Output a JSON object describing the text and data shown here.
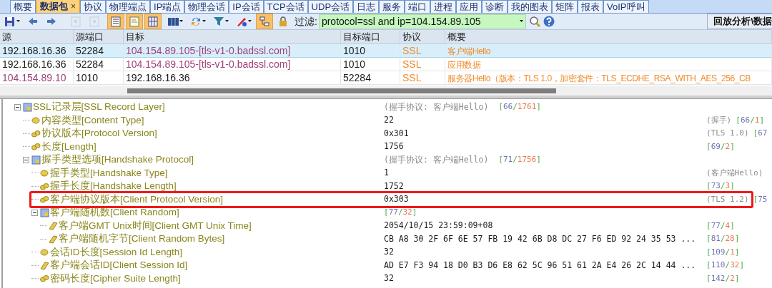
{
  "tabs": [
    {
      "label": "概要",
      "selected": false
    },
    {
      "label": "数据包",
      "selected": true,
      "close_glyph": "×"
    },
    {
      "label": "协议",
      "selected": false
    },
    {
      "label": "物理端点",
      "selected": false
    },
    {
      "label": "IP端点",
      "selected": false
    },
    {
      "label": "物理会话",
      "selected": false
    },
    {
      "label": "IP会话",
      "selected": false
    },
    {
      "label": "TCP会话",
      "selected": false
    },
    {
      "label": "UDP会话",
      "selected": false
    },
    {
      "label": "日志",
      "selected": false
    },
    {
      "label": "服务",
      "selected": false
    },
    {
      "label": "端口",
      "selected": false
    },
    {
      "label": "进程",
      "selected": false
    },
    {
      "label": "应用",
      "selected": false
    },
    {
      "label": "诊断",
      "selected": false
    },
    {
      "label": "我的图表",
      "selected": false
    },
    {
      "label": "矩阵",
      "selected": false
    },
    {
      "label": "报表",
      "selected": false
    },
    {
      "label": "VoIP呼叫",
      "selected": false
    }
  ],
  "toolbar": {
    "buttons": [
      {
        "kind": "save",
        "on": false,
        "disabled": false,
        "dropdown": true
      },
      {
        "kind": "back",
        "on": false,
        "disabled": false,
        "dropdown": false
      },
      {
        "kind": "forward",
        "on": false,
        "disabled": false,
        "dropdown": false
      },
      {
        "kind": "first",
        "on": false,
        "disabled": true,
        "dropdown": false
      },
      {
        "kind": "last",
        "on": false,
        "disabled": true,
        "dropdown": false
      },
      {
        "kind": "list",
        "on": true,
        "disabled": false,
        "dropdown": false
      },
      {
        "kind": "detail",
        "on": true,
        "disabled": false,
        "dropdown": false
      },
      {
        "kind": "hex",
        "on": true,
        "disabled": false,
        "dropdown": false
      },
      {
        "kind": "columns",
        "on": false,
        "disabled": false,
        "dropdown": true
      },
      {
        "kind": "sync",
        "on": false,
        "disabled": false,
        "dropdown": true
      },
      {
        "kind": "filter",
        "on": false,
        "disabled": false,
        "dropdown": true
      },
      {
        "kind": "colors",
        "on": false,
        "disabled": false,
        "dropdown": true
      },
      {
        "kind": "tree",
        "on": true,
        "disabled": false,
        "dropdown": false
      },
      {
        "kind": "lock",
        "on": false,
        "disabled": false,
        "dropdown": false
      }
    ],
    "filter": {
      "label": "过滤:",
      "value": "protocol=ssl and ip=104.154.89.105"
    },
    "filter_buttons": [
      {
        "kind": "search"
      },
      {
        "kind": "help"
      }
    ],
    "right_button": "回放分析\\数据"
  },
  "packets": {
    "columns": [
      "源",
      "源端口",
      "目标",
      "目标端口",
      "协议",
      "概要"
    ],
    "rows": [
      {
        "selected": true,
        "cells": [
          {
            "text": "192.168.16.36",
            "kind": "plain"
          },
          {
            "text": "52284",
            "kind": "plain"
          },
          {
            "text": "104.154.89.105-[tls-v1-0.badssl.com]",
            "kind": "host"
          },
          {
            "text": "1010",
            "kind": "plain"
          },
          {
            "text": "SSL",
            "kind": "proto"
          },
          {
            "text": "客户端Hello",
            "kind": "proto"
          }
        ]
      },
      {
        "selected": false,
        "cells": [
          {
            "text": "192.168.16.36",
            "kind": "plain"
          },
          {
            "text": "52284",
            "kind": "plain"
          },
          {
            "text": "104.154.89.105-[tls-v1-0.badssl.com]",
            "kind": "host"
          },
          {
            "text": "1010",
            "kind": "plain"
          },
          {
            "text": "SSL",
            "kind": "proto"
          },
          {
            "text": "应用数据",
            "kind": "proto"
          }
        ]
      },
      {
        "selected": false,
        "cells": [
          {
            "text": "104.154.89.10",
            "kind": "host"
          },
          {
            "text": "1010",
            "kind": "plain"
          },
          {
            "text": "192.168.16.36",
            "kind": "plain"
          },
          {
            "text": "52284",
            "kind": "plain"
          },
          {
            "text": "SSL",
            "kind": "proto"
          },
          {
            "text": "服务器Hello（版本：TLS 1.0，加密套件：TLS_ECDHE_RSA_WITH_AES_256_CB",
            "kind": "proto"
          }
        ]
      }
    ]
  },
  "details": {
    "tree": [
      {
        "kind": "group",
        "name": "SSL记录层[SSL Record Layer]",
        "expanded": true,
        "highlighted": false,
        "summary": "(握手协议: 客户端Hello)",
        "offset": {
          "open": "[",
          "start": "66",
          "sep": "/",
          "length": "1761",
          "close": "]"
        },
        "children": [
          {
            "kind": "byte",
            "name": "内容类型[Content Type]",
            "highlighted": false,
            "value": "22",
            "note": "(握手)",
            "offset": {
              "open": "[",
              "start": "66",
              "sep": "/",
              "length": "1",
              "close": "]"
            }
          },
          {
            "kind": "word",
            "name": "协议版本[Protocol Version]",
            "highlighted": false,
            "value": "0x301",
            "note": "(TLS 1.0)",
            "offset": {
              "open": "[",
              "start": "67"
            }
          },
          {
            "kind": "word",
            "name": "长度[Length]",
            "highlighted": false,
            "value": "1756",
            "offset": {
              "open": "[",
              "start": "69",
              "sep": "/",
              "length": "2",
              "close": "]"
            }
          },
          {
            "kind": "group",
            "name": "握手类型选项[Handshake Protocol]",
            "expanded": true,
            "highlighted": false,
            "summary": "(握手协议: 客户端Hello)",
            "offset": {
              "open": "[",
              "start": "71",
              "sep": "/",
              "length": "1756",
              "close": "]"
            },
            "children": [
              {
                "kind": "byte",
                "name": "握手类型[Handshake Type]",
                "highlighted": false,
                "value": "1",
                "note": "(客户端Hello)"
              },
              {
                "kind": "word",
                "name": "握手长度[Handshake Length]",
                "highlighted": false,
                "value": "1752",
                "offset": {
                  "open": "[",
                  "start": "73",
                  "sep": "/",
                  "length": "3",
                  "close": "]"
                }
              },
              {
                "kind": "word",
                "name": "客户端协议版本[Client Protocol Version]",
                "highlighted": true,
                "value": "0x303",
                "note": "(TLS 1.2)",
                "offset": {
                  "open": "[",
                  "start": "75"
                }
              },
              {
                "kind": "group",
                "name": "客户端随机数[Client Random]",
                "expanded": true,
                "highlighted": false,
                "offset": {
                  "open": "[",
                  "start": "77",
                  "sep": "/",
                  "length": "32",
                  "close": "]"
                },
                "children": [
                  {
                    "kind": "bytes",
                    "name": "客户端GMT Unix时间[Client GMT Unix Time]",
                    "highlighted": false,
                    "value": "2054/10/15 23:59:09+08",
                    "offset": {
                      "open": "[",
                      "start": "77",
                      "sep": "/",
                      "length": "4",
                      "close": "]"
                    }
                  },
                  {
                    "kind": "bytes",
                    "name": "客户端随机字节[Client Random Bytes]",
                    "highlighted": false,
                    "value": "CB A8 30 2F 6F 6E 57 FB 19 42 6B D8 DC 27 F6 ED 92 24 35 53 ...",
                    "offset": {
                      "open": "[",
                      "start": "81",
                      "sep": "/",
                      "length": "28",
                      "close": "]"
                    }
                  }
                ]
              },
              {
                "kind": "byte",
                "name": "会话ID长度[Session Id Length]",
                "highlighted": false,
                "value": "32",
                "offset": {
                  "open": "[",
                  "start": "109",
                  "sep": "/",
                  "length": "1",
                  "close": "]"
                }
              },
              {
                "kind": "bytes",
                "name": "客户端会话ID[Client Session Id]",
                "highlighted": false,
                "value": "AD E7 F3 94 18 D0 B3 D6 E8 62 5C 96 51 61 2A E4 26 2C 14 44 ...",
                "offset": {
                  "open": "[",
                  "start": "110",
                  "sep": "/",
                  "length": "32",
                  "close": "]"
                }
              },
              {
                "kind": "word",
                "name": "密码长度[Cipher Suite Length]",
                "highlighted": false,
                "value": "32",
                "offset": {
                  "open": "[",
                  "start": "142",
                  "sep": "/",
                  "length": "2",
                  "close": "]"
                }
              }
            ]
          }
        ]
      }
    ]
  }
}
